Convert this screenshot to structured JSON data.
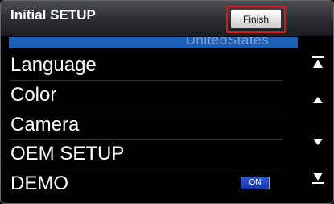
{
  "header": {
    "title": "Initial SETUP",
    "finish_label": "Finish",
    "highlight_color": "#d11a22"
  },
  "list": {
    "partial_item": "UnitedStates",
    "items": [
      {
        "label": "Language"
      },
      {
        "label": "Color"
      },
      {
        "label": "Camera"
      },
      {
        "label": "OEM SETUP"
      },
      {
        "label": "DEMO",
        "badge": "ON"
      }
    ]
  },
  "scrollbar": {
    "icons": [
      "page-up-icon",
      "line-up-icon",
      "line-down-icon",
      "page-down-icon"
    ]
  },
  "colors": {
    "accent": "#1c5fb8",
    "background": "#000000",
    "text": "#ffffff"
  }
}
